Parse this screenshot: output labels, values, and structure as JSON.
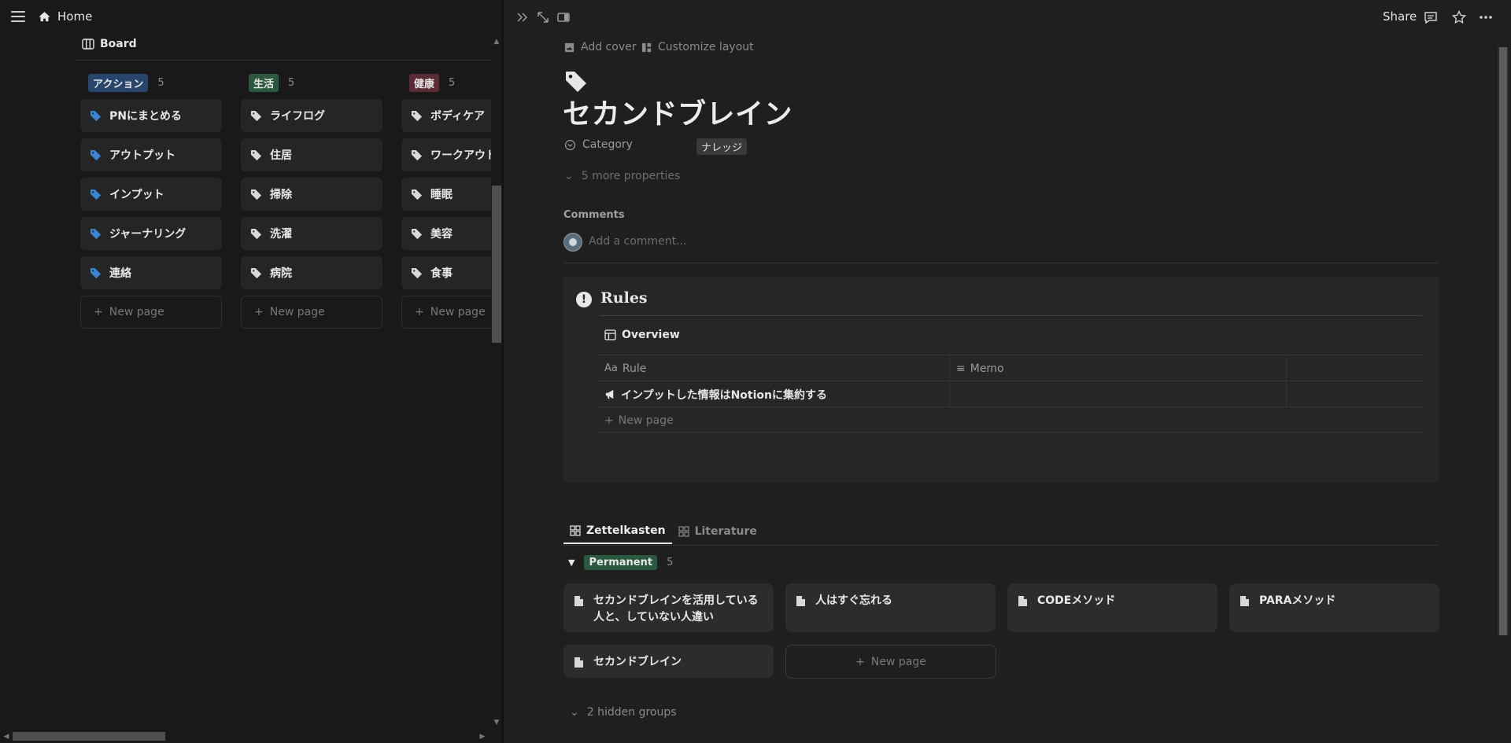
{
  "left": {
    "home_label": "Home",
    "board_label": "Board",
    "new_page_label": "New page",
    "columns": [
      {
        "tag": "アクション",
        "count": "5",
        "items": [
          "PNにまとめる",
          "アウトプット",
          "インプット",
          "ジャーナリング",
          "連絡"
        ]
      },
      {
        "tag": "生活",
        "count": "5",
        "items": [
          "ライフログ",
          "住居",
          "掃除",
          "洗濯",
          "病院"
        ]
      },
      {
        "tag": "健康",
        "count": "5",
        "items": [
          "ボディケア",
          "ワークアウト",
          "睡眠",
          "美容",
          "食事"
        ]
      }
    ]
  },
  "topbar": {
    "share_label": "Share"
  },
  "page": {
    "add_cover": "Add cover",
    "customize_layout": "Customize layout",
    "title": "セカンドブレイン",
    "property_name": "Category",
    "property_value": "ナレッジ",
    "more_properties": "5 more properties",
    "comments_label": "Comments",
    "comment_placeholder": "Add a comment..."
  },
  "callout": {
    "title": "Rules",
    "db_title": "Overview",
    "col_rule": "Rule",
    "col_memo": "Memo",
    "rows": [
      "インプットした情報はNotionに集約する"
    ],
    "new_page": "New page"
  },
  "tabs": [
    "Zettelkasten",
    "Literature"
  ],
  "group": {
    "tag": "Permanent",
    "count": "5",
    "cards": [
      "セカンドブレインを活用している人と、していない人違い",
      "人はすぐ忘れる",
      "CODEメソッド",
      "PARAメソッド",
      "セカンドブレイン"
    ],
    "new_page": "New page",
    "hidden_groups": "2 hidden groups"
  },
  "colors": {
    "bg_left": "#191919",
    "bg_right": "#1f1f1f",
    "tag_action": "#28456c",
    "tag_life": "#2b593f",
    "tag_health": "#5a2a35",
    "icon_blue": "#3b86d1"
  },
  "icons": {
    "action_item": "tag-icon-blue",
    "life_item": "tag-icon-gray",
    "health_item": "tag-icon-gray",
    "group_card": "document-icon",
    "db_row": "megaphone-icon"
  }
}
